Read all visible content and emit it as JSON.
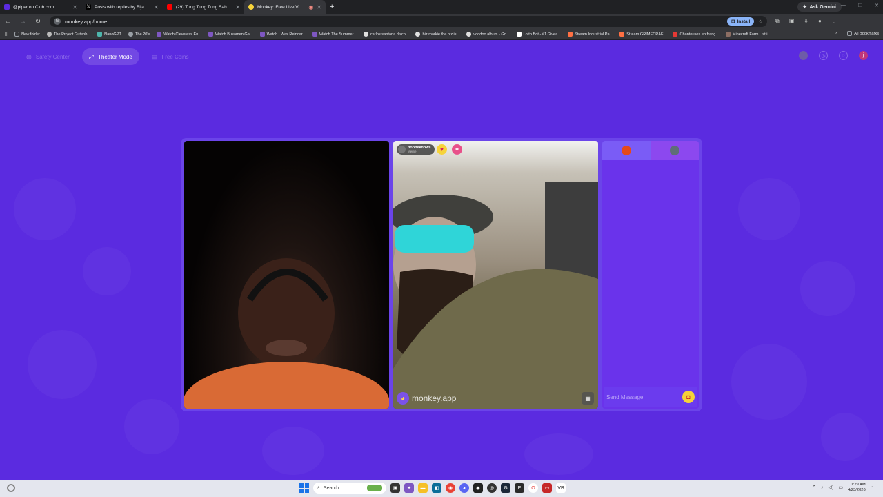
{
  "tabs": [
    {
      "title": "@piper on Club.com",
      "color": "#5b2be0",
      "active": false
    },
    {
      "title": "Posts with replies by Bijan Tehrani",
      "color": "#000000",
      "active": false
    },
    {
      "title": "(29) Tung Tung Tung Sahur - Re...",
      "color": "#ff0000",
      "active": false
    },
    {
      "title": "Monkey: Free Live Video Chat",
      "color": "#f6d33a",
      "active": true
    }
  ],
  "gemini_label": "Ask Gemini",
  "address": {
    "url": "monkey.app/home",
    "install_label": "Install"
  },
  "bookmarks": [
    {
      "label": "New folder",
      "color": "#9aa0a6"
    },
    {
      "label": "The Project Gutenb...",
      "color": "#bbbbbb"
    },
    {
      "label": "NanoGPT",
      "color": "#4db6ac"
    },
    {
      "label": "The 20's",
      "color": "#9aa0a6"
    },
    {
      "label": "Watch Clevatess En...",
      "color": "#7e57c2"
    },
    {
      "label": "Watch Busamen Ga...",
      "color": "#7e57c2"
    },
    {
      "label": "Watch I Was Reincar...",
      "color": "#7e57c2"
    },
    {
      "label": "Watch The Summer...",
      "color": "#7e57c2"
    },
    {
      "label": "carlos santana disco...",
      "color": "#e0e0e0"
    },
    {
      "label": "biz markie the biz is...",
      "color": "#e0e0e0"
    },
    {
      "label": "voodoo album - Go...",
      "color": "#e0e0e0"
    },
    {
      "label": "Lotto Bot - #1 Givea...",
      "color": "#ffffff"
    },
    {
      "label": "Stream Industrial Pa...",
      "color": "#ff7043"
    },
    {
      "label": "Stream GRIMECRAF...",
      "color": "#ff7043"
    },
    {
      "label": "Chanteuses en franç...",
      "color": "#e53935"
    },
    {
      "label": "Minecraft Farm List i...",
      "color": "#8d6e63"
    }
  ],
  "all_bookmarks": "All Bookmarks",
  "nav": {
    "safety": "Safety Center",
    "theater": "Theater Mode",
    "coins": "Free Coins"
  },
  "remote_user": {
    "name": "nooneknows",
    "status": "Meme"
  },
  "watermark": "monkey.app",
  "chat": {
    "placeholder": "Send Message"
  },
  "taskbar": {
    "search": "Search",
    "time": "1:29 AM",
    "date": "4/23/2026"
  },
  "colors": {
    "page_bg": "#5b2be0",
    "accent": "#f6d33a"
  }
}
